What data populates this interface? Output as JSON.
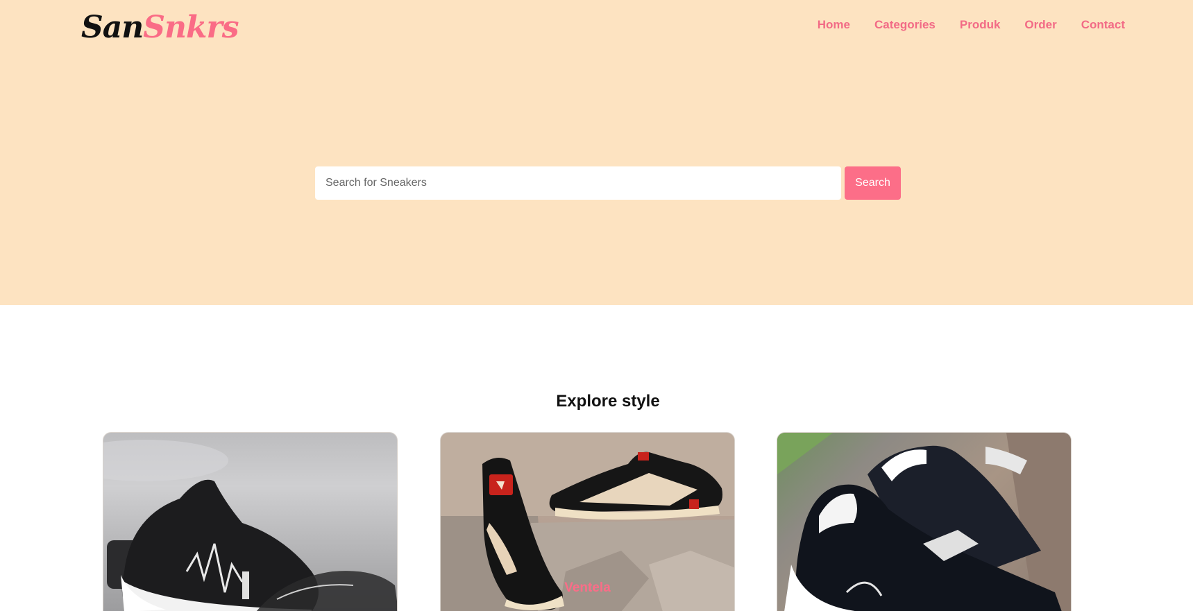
{
  "brand": {
    "part1": "San",
    "part2": "Snkrs",
    "colors": {
      "dark": "#111111",
      "accent": "#fa6c86"
    }
  },
  "nav": {
    "items": [
      {
        "label": "Home"
      },
      {
        "label": "Categories"
      },
      {
        "label": "Produk"
      },
      {
        "label": "Order"
      },
      {
        "label": "Contact"
      }
    ]
  },
  "hero": {
    "background": "#fde3c1",
    "search": {
      "placeholder": "Search for Sneakers",
      "value": "",
      "button_label": "Search",
      "button_color": "#fc6e88"
    }
  },
  "explore": {
    "title": "Explore style",
    "cards": [
      {
        "label": "",
        "image": "black-white-sneaker-photo-icon"
      },
      {
        "label": "Ventela",
        "image": "black-cream-sneakers-on-stone-photo-icon"
      },
      {
        "label": "",
        "image": "navy-white-sneakers-photo-icon"
      }
    ]
  }
}
